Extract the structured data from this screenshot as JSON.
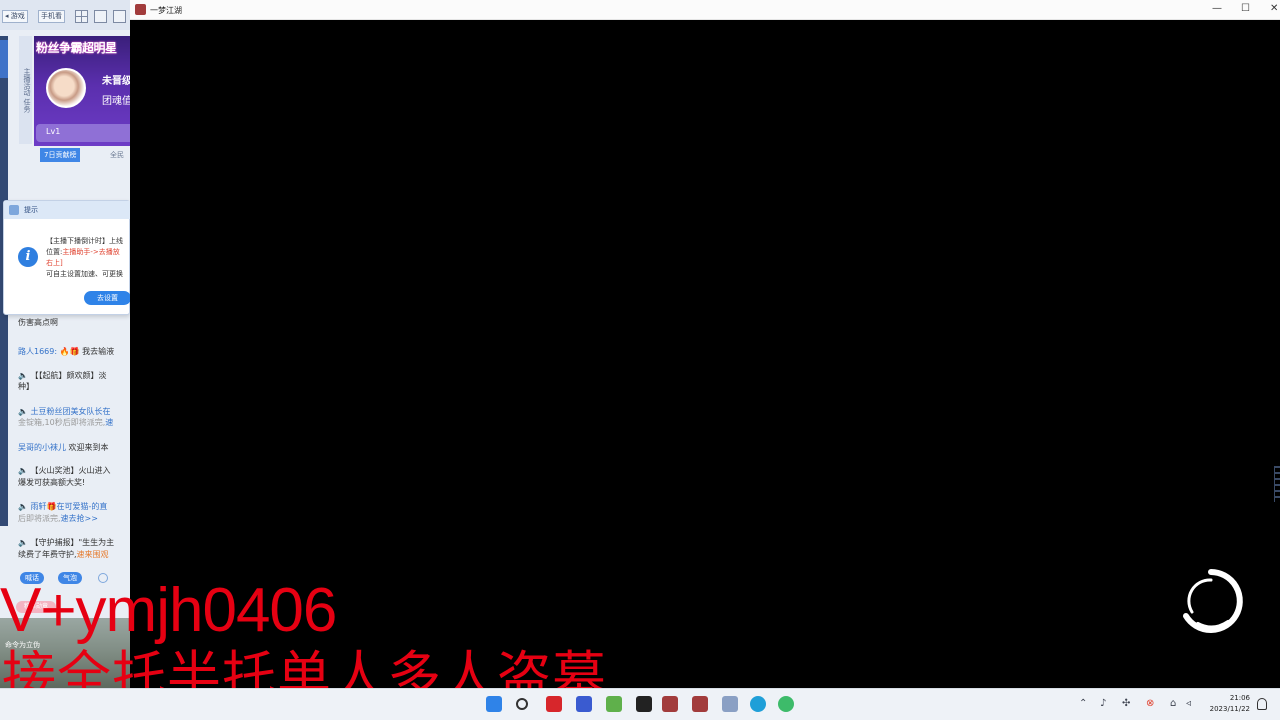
{
  "left_panel": {
    "top_buttons": [
      "◂ 游戏",
      "手机看"
    ],
    "vertical_tabs": "主播活动 任务",
    "banner": {
      "title": "粉丝争霸超明星",
      "name": "未晋级",
      "sub": "团魂值",
      "level": "Lv1"
    },
    "rank_tabs": [
      "7日贡献榜",
      "全民"
    ],
    "popup": {
      "title": "提示",
      "line1": "【主播下播倒计时】上线",
      "line2_prefix": "位置:",
      "line2_link": "主播助手->去播放",
      "line3": "右上]",
      "line4": "可自主设置加速、可更换",
      "button": "去设置"
    },
    "chat": [
      {
        "text": "伤害高点啊"
      },
      {
        "user": "路人1669:",
        "text": "🔥🎁 我去输液"
      },
      {
        "text": "🔈 【【起航】颇欢颜】淡"
      },
      {
        "text": "种】"
      },
      {
        "link": "土豆粉丝团美女队长在",
        "text": ""
      },
      {
        "text": "金锭箱,10秒后即将派完,",
        "link": "速"
      },
      {
        "user": "吴哥的小袜儿",
        "text": "欢迎来到本"
      },
      {
        "text": "🔈 【火山奖池】火山进入"
      },
      {
        "text": "爆发可获高额大奖!"
      },
      {
        "link": "雨轩🎁在可爱猫-的直",
        "text": ""
      },
      {
        "text": "后即将派完,",
        "link": "速去抢>>"
      },
      {
        "text": "🔈 【守护捕报】\"生生为主"
      },
      {
        "text": "续费了年费守护,",
        "link": "速来围观"
      }
    ],
    "pills": [
      "喊话",
      "气泡"
    ],
    "badge": "粉丝勋章",
    "bottom_caption": "命令为立伪"
  },
  "game_window": {
    "title": "一梦江湖",
    "controls": [
      "—",
      "☐",
      "✕"
    ]
  },
  "overlay": {
    "line1": "V+ymjh0406",
    "line2": "接全托半托单人多人盗墓"
  },
  "taskbar": {
    "clock_time": "21:06",
    "clock_date": "2023/11/22",
    "accent": "#2f83e8"
  },
  "colors": {
    "watermark": "#e60012",
    "game_bg": "#000000",
    "banner_purple": "#5b2fae"
  }
}
